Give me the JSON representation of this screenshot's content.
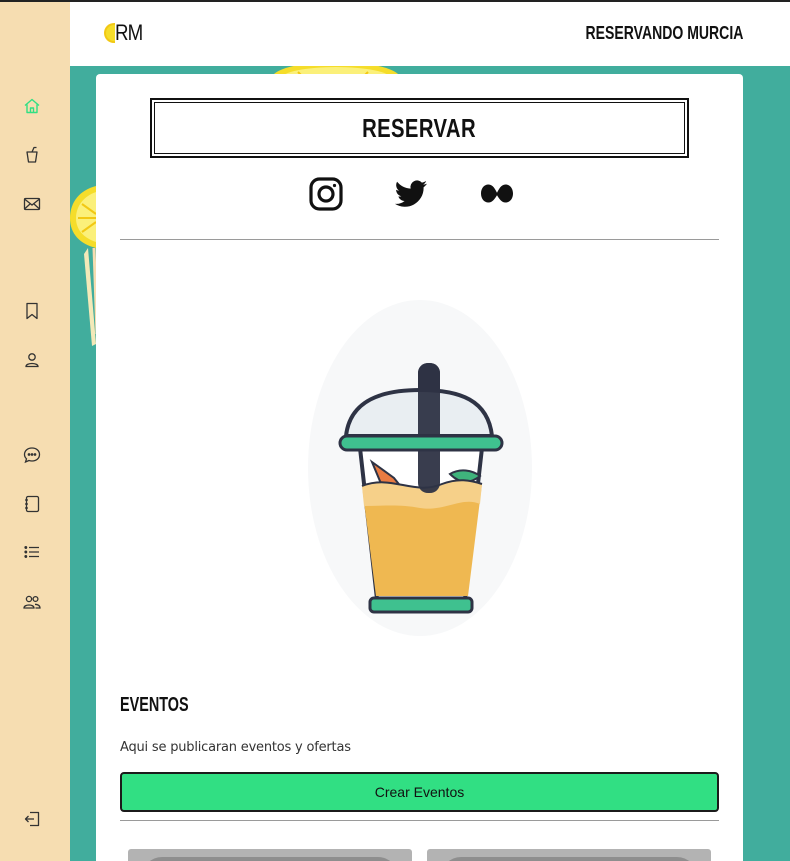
{
  "header": {
    "logo_text": "RM",
    "brand": "RESERVANDO MURCIA"
  },
  "sidebar": {
    "items": [
      {
        "name": "home",
        "icon": "home-icon",
        "active": true
      },
      {
        "name": "drinks",
        "icon": "cup-icon"
      },
      {
        "name": "messages",
        "icon": "mail-icon"
      },
      {
        "name": "saved",
        "icon": "bookmark-icon"
      },
      {
        "name": "profile",
        "icon": "user-icon"
      },
      {
        "name": "chat",
        "icon": "chat-bubble-icon"
      },
      {
        "name": "notebook",
        "icon": "notebook-icon"
      },
      {
        "name": "list",
        "icon": "list-icon"
      },
      {
        "name": "groups",
        "icon": "users-icon"
      },
      {
        "name": "logout",
        "icon": "logout-icon"
      }
    ]
  },
  "main": {
    "reserve_label": "RESERVAR",
    "social": [
      "instagram-icon",
      "twitter-icon",
      "flickr-icon"
    ],
    "hero_image": "iced-drink-illustration",
    "events_title": "EVENTOS",
    "events_subtitle": "Aqui se publicaran eventos y ofertas",
    "create_events_label": "Crear Eventos"
  },
  "colors": {
    "background": "#41ad9d",
    "sidebar": "#f6ddb1",
    "active_icon": "#31df83",
    "create_button": "#31df83",
    "lemon": "#f5dd2a"
  }
}
